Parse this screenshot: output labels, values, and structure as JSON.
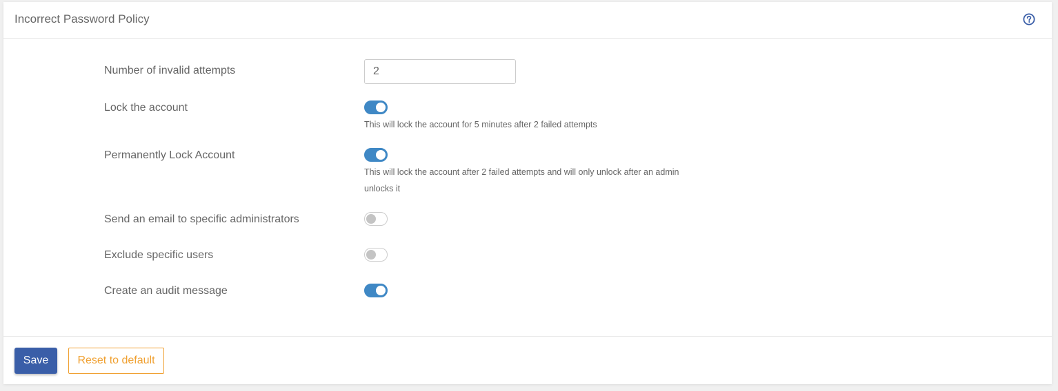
{
  "header": {
    "title": "Incorrect Password Policy",
    "help_icon": "question-circle-icon"
  },
  "settings": {
    "invalid_attempts": {
      "label": "Number of invalid attempts",
      "value": "2"
    },
    "lock_account": {
      "label": "Lock the account",
      "enabled": true,
      "help": "This will lock the account for 5 minutes after 2 failed attempts"
    },
    "permanent_lock": {
      "label": "Permanently Lock Account",
      "enabled": true,
      "help_line1": "This will lock the account after 2 failed attempts and will only unlock after an admin",
      "help_line2": "unlocks it"
    },
    "email_admins": {
      "label": "Send an email to specific administrators",
      "enabled": false
    },
    "exclude_users": {
      "label": "Exclude specific users",
      "enabled": false
    },
    "audit_message": {
      "label": "Create an audit message",
      "enabled": true
    }
  },
  "footer": {
    "save_label": "Save",
    "reset_label": "Reset to default"
  },
  "colors": {
    "toggle_on": "#3f88c5",
    "save_button": "#3a5ea8",
    "reset_button": "#f0a030",
    "help_icon": "#3a5ea8"
  }
}
